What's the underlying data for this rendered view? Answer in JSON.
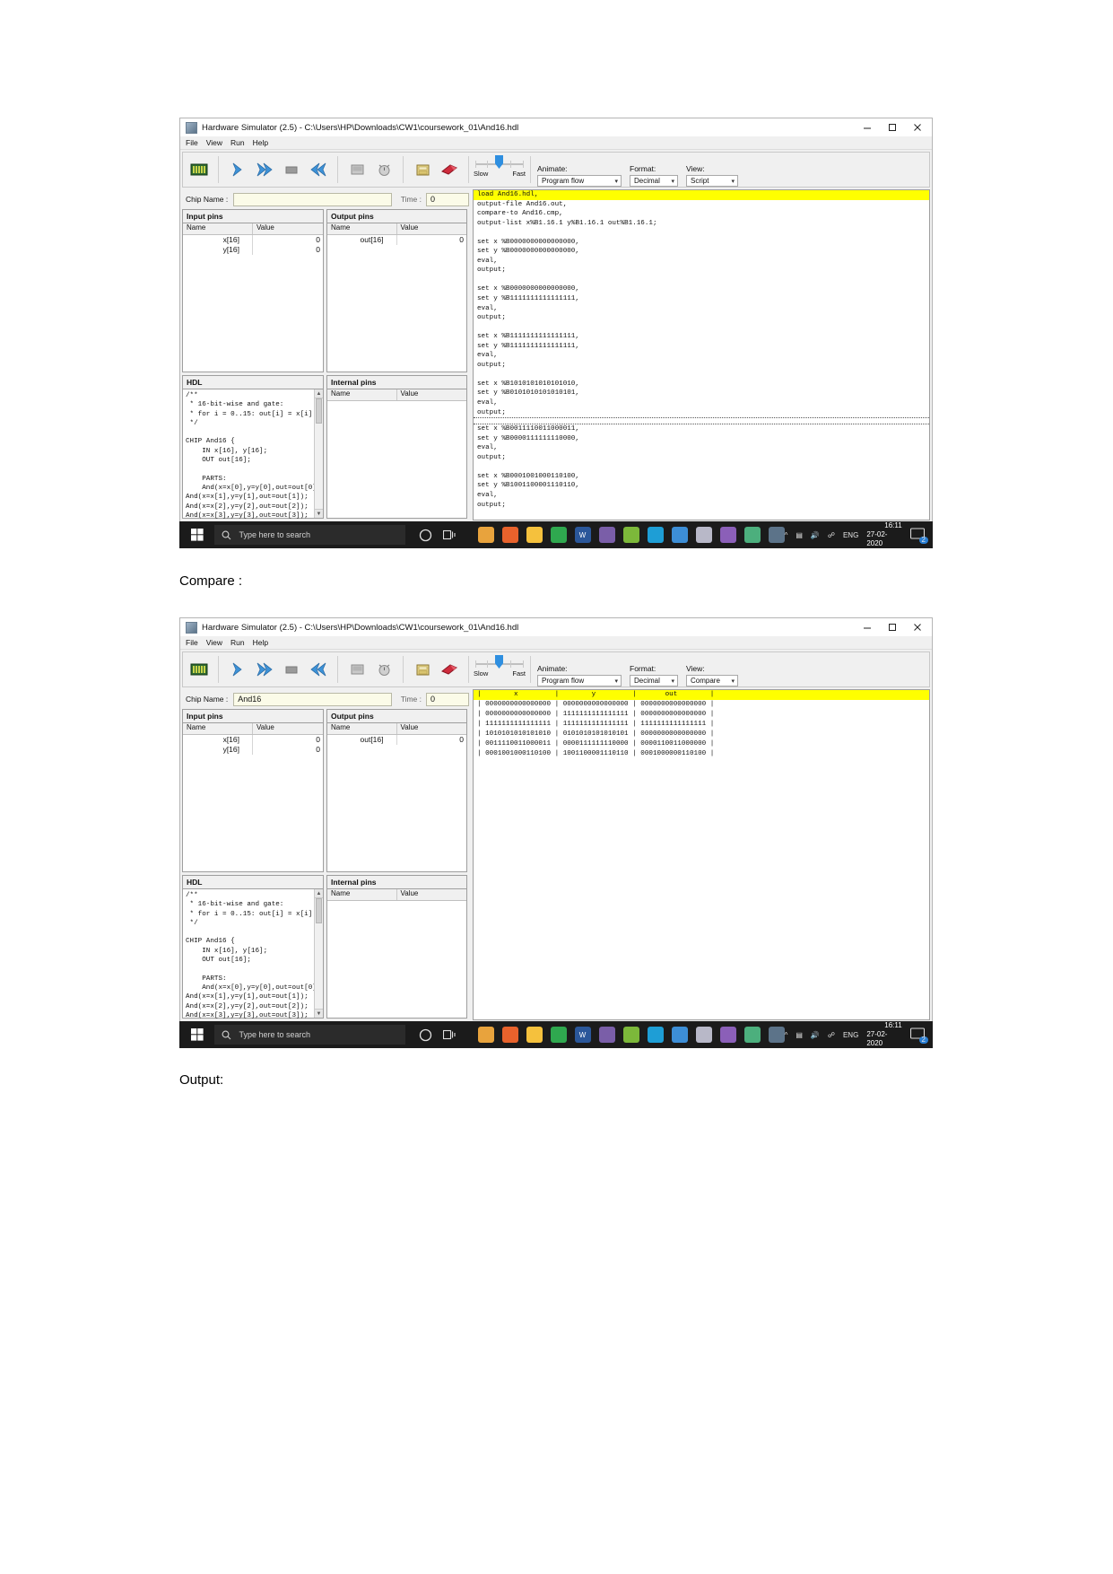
{
  "document": {
    "label_compare": "Compare :",
    "label_output": "Output:"
  },
  "window": {
    "title": "Hardware Simulator (2.5) - C:\\Users\\HP\\Downloads\\CW1\\coursework_01\\And16.hdl",
    "icon": "app-icon",
    "controls": {
      "minimize": "minimize-icon",
      "maximize": "maximize-icon",
      "close": "close-icon"
    },
    "menus": [
      "File",
      "View",
      "Run",
      "Help"
    ],
    "toolbar": {
      "buttons": [
        {
          "name": "load-chip-button",
          "icon": "chip-icon"
        },
        {
          "name": "single-step-button",
          "icon": "single-arrow-icon"
        },
        {
          "name": "run-button",
          "icon": "double-arrow-icon"
        },
        {
          "name": "stop-button",
          "icon": "stop-square-icon"
        },
        {
          "name": "rewind-button",
          "icon": "rewind-icon"
        },
        {
          "name": "load-script-button",
          "icon": "script-icon"
        },
        {
          "name": "clear-button",
          "icon": "clock-icon"
        },
        {
          "name": "save-script-button",
          "icon": "save-icon"
        },
        {
          "name": "help-button",
          "icon": "bookmark-icon"
        }
      ],
      "speed": {
        "slow_label": "Slow",
        "fast_label": "Fast"
      },
      "animate": {
        "label": "Animate:",
        "value": "Program flow"
      },
      "format": {
        "label": "Format:",
        "value": "Decimal"
      },
      "view_script": {
        "label": "View:",
        "value": "Script"
      },
      "view_compare": {
        "label": "View:",
        "value": "Compare"
      }
    },
    "chip": {
      "label": "Chip Name :",
      "value_empty": "",
      "value_filled": "And16",
      "time_label": "Time :",
      "time_value": "0"
    },
    "panes": {
      "input_pins": {
        "title": "Input pins",
        "columns": [
          "Name",
          "Value"
        ],
        "rows": [
          {
            "name": "x[16]",
            "value": "0"
          },
          {
            "name": "y[16]",
            "value": "0"
          }
        ]
      },
      "output_pins": {
        "title": "Output pins",
        "columns": [
          "Name",
          "Value"
        ],
        "rows": [
          {
            "name": "out[16]",
            "value": "0"
          }
        ]
      },
      "hdl": {
        "title": "HDL",
        "code": "/**\n * 16-bit-wise and gate:\n * for i = 0..15: out[i] = x[i]\n */\n\nCHIP And16 {\n    IN x[16], y[16];\n    OUT out[16];\n\n    PARTS:\n    And(x=x[0],y=y[0],out=out[0]\nAnd(x=x[1],y=y[1],out=out[1]);\nAnd(x=x[2],y=y[2],out=out[2]);\nAnd(x=x[3],y=y[3],out=out[3]);"
      },
      "internal_pins": {
        "title": "Internal pins",
        "columns": [
          "Name",
          "Value"
        ],
        "rows": []
      }
    },
    "script": {
      "highlighted_line": "load And16.hdl,",
      "before_cursor": "output-file And16.out,\ncompare-to And16.cmp,\noutput-list x%B1.16.1 y%B1.16.1 out%B1.16.1;\n\nset x %B0000000000000000,\nset y %B0000000000000000,\neval,\noutput;\n\nset x %B0000000000000000,\nset y %B1111111111111111,\neval,\noutput;\n\nset x %B1111111111111111,\nset y %B1111111111111111,\neval,\noutput;\n\nset x %B1010101010101010,\nset y %B0101010101010101,\neval,\noutput;",
      "after_cursor": "set x %B0011110011000011,\nset y %B0000111111110000,\neval,\noutput;\n\nset x %B0001001000110100,\nset y %B1001100001110110,\neval,\noutput;"
    },
    "compare": {
      "header": "|        x         |        y         |       out        |",
      "rows": [
        "| 0000000000000000 | 0000000000000000 | 0000000000000000 |",
        "| 0000000000000000 | 1111111111111111 | 0000000000000000 |",
        "| 1111111111111111 | 1111111111111111 | 1111111111111111 |",
        "| 1010101010101010 | 0101010101010101 | 0000000000000000 |",
        "| 0011110011000011 | 0000111111110000 | 0000110011000000 |",
        "| 0001001000110100 | 1001100001110110 | 0001000000110100 |"
      ]
    }
  },
  "taskbar": {
    "start": "windows-start-icon",
    "search_placeholder": "Type here to search",
    "search_icon": "search-icon",
    "cortana_icon": "cortana-circle-icon",
    "taskview_icon": "task-view-icon",
    "apps": [
      {
        "name": "chrome-icon",
        "color": "#e8a33d"
      },
      {
        "name": "firefox-icon",
        "color": "#e8622c"
      },
      {
        "name": "file-explorer-icon",
        "color": "#f5c13d"
      },
      {
        "name": "browser-globe-icon",
        "color": "#2fa84f"
      },
      {
        "name": "word-icon",
        "color": "#2b579a"
      },
      {
        "name": "media-player-icon",
        "color": "#7a5ea8"
      },
      {
        "name": "utorrent-icon",
        "color": "#7cb83a"
      },
      {
        "name": "edge-icon",
        "color": "#1e9ed6"
      },
      {
        "name": "photos-icon",
        "color": "#3d8ed6"
      },
      {
        "name": "java-icon",
        "color": "#b8b8c8"
      },
      {
        "name": "antivirus-icon",
        "color": "#8b5fb8"
      },
      {
        "name": "notes-icon",
        "color": "#4caf7d"
      },
      {
        "name": "hardware-sim-icon",
        "color": "#5c7389"
      }
    ],
    "tray": {
      "chevron": "show-hidden-icons-chevron",
      "battery": "battery-icon",
      "volume": "volume-icon",
      "network": "network-icon",
      "language": "ENG",
      "time": "16:11",
      "date": "27-02-2020",
      "notifications_icon": "action-center-icon",
      "notifications_count": "2"
    }
  }
}
